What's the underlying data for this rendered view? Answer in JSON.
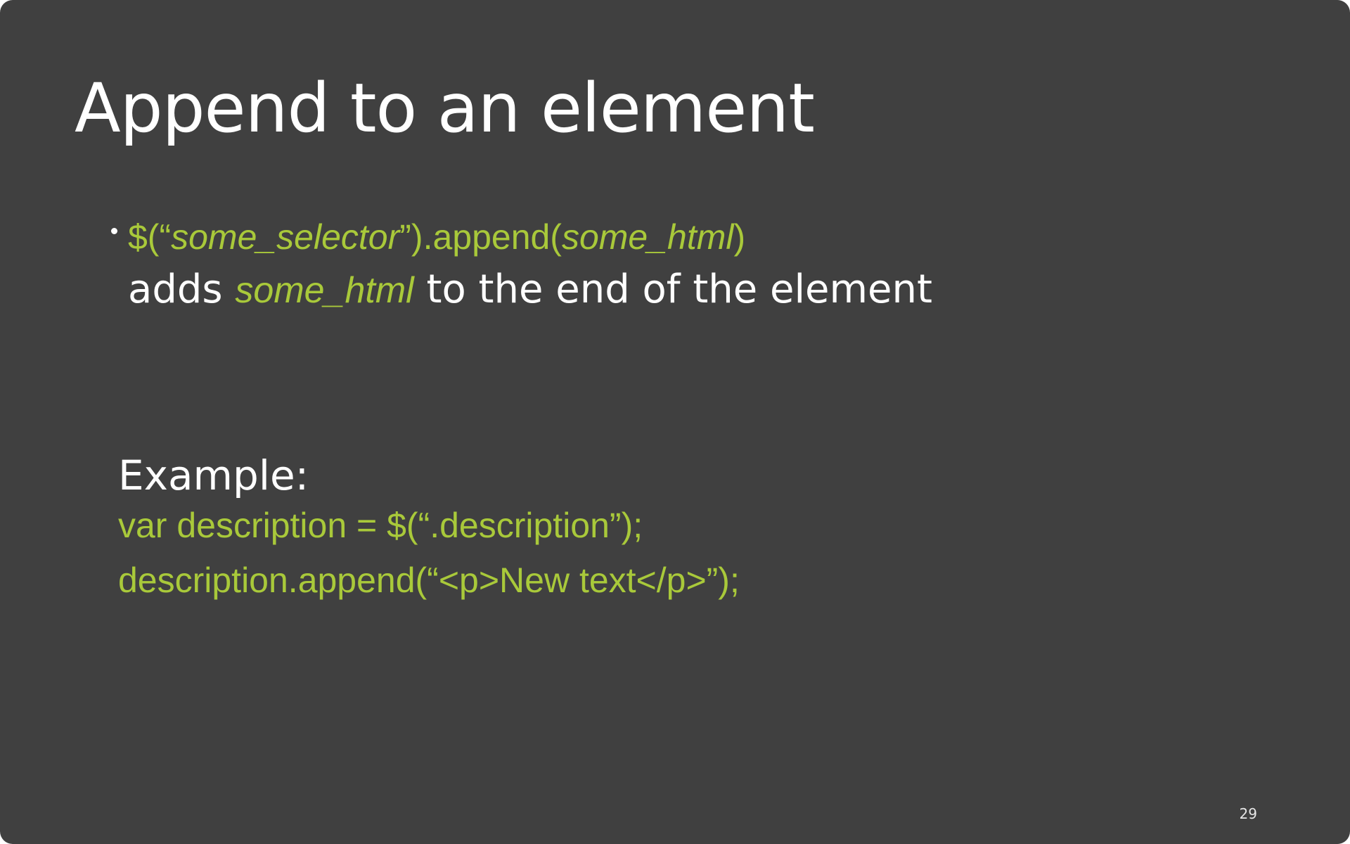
{
  "slide": {
    "title": "Append to an element",
    "bullet": {
      "code_prefix": "$(“",
      "code_arg1": "some_selector",
      "code_mid": "”).append(",
      "code_arg2": "some_html",
      "code_suffix": ")",
      "desc_prefix": "adds",
      "desc_code": "some_html",
      "desc_suffix": "to the end of the element"
    },
    "example_label": "Example:",
    "code_lines": [
      "var description = $(“.description”);",
      "description.append(“<p>New text</p>”);"
    ],
    "page_number": "29"
  },
  "colors": {
    "background": "#404040",
    "text": "#ffffff",
    "code": "#a9c93a"
  }
}
